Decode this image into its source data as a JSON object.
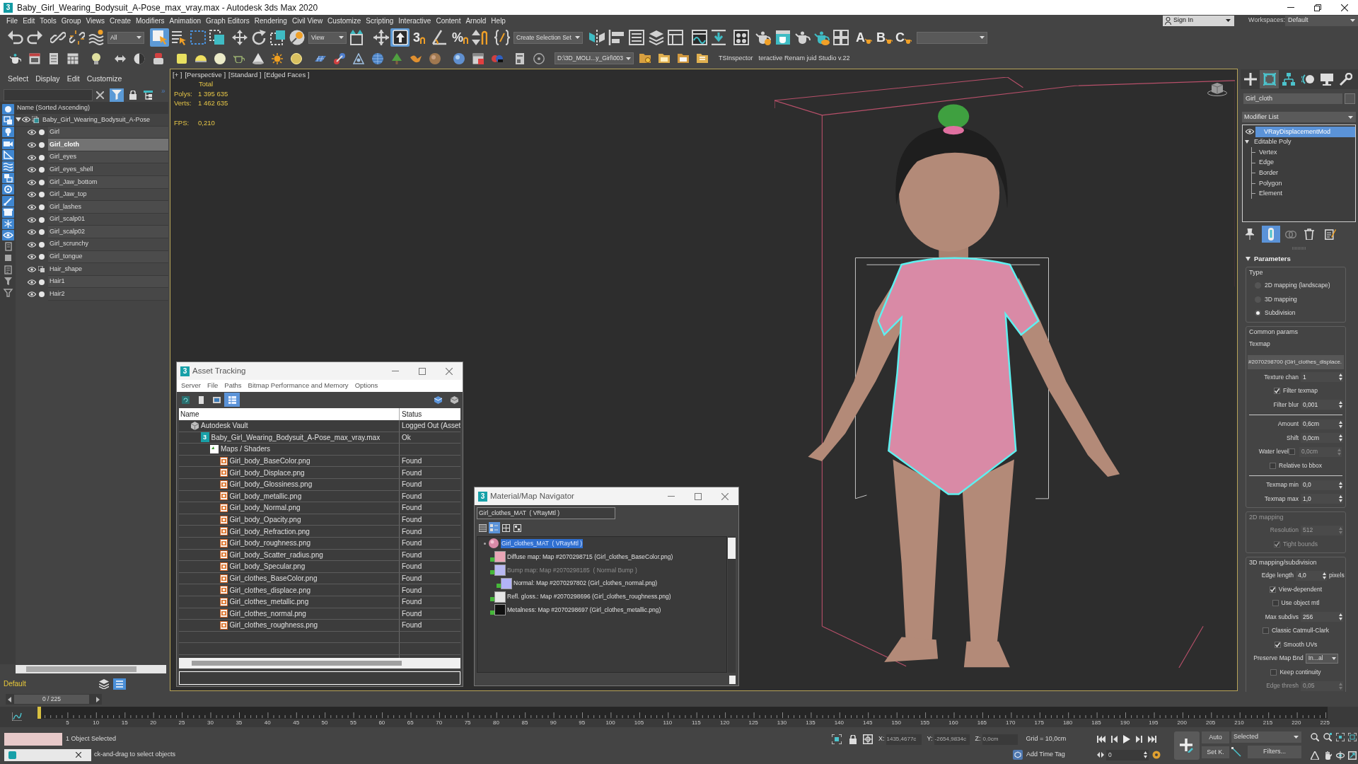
{
  "window": {
    "title": "Baby_Girl_Wearing_Bodysuit_A-Pose_max_vray.max - Autodesk 3ds Max 2020",
    "icon_label": "3"
  },
  "menu_bar": [
    "File",
    "Edit",
    "Tools",
    "Group",
    "Views",
    "Create",
    "Modifiers",
    "Animation",
    "Graph Editors",
    "Rendering",
    "Civil View",
    "Customize",
    "Scripting",
    "Interactive",
    "Content",
    "Arnold",
    "Help"
  ],
  "account": {
    "sign_in": "Sign In",
    "workspaces_label": "Workspaces:",
    "workspace": "Default"
  },
  "main_toolbar": [
    {
      "kind": "tool",
      "selected": false
    },
    {
      "kind": "tool",
      "selected": false
    },
    {
      "kind": "tool",
      "selected": false
    },
    {
      "kind": "tool",
      "selected": false
    },
    {
      "kind": "tool",
      "selected": false
    },
    {
      "kind": "dropdown",
      "value": "All"
    },
    {
      "kind": "tool",
      "selected": true
    },
    {
      "kind": "tool",
      "selected": false
    },
    {
      "kind": "tool",
      "selected": false
    },
    {
      "kind": "tool",
      "selected": false
    },
    {
      "kind": "tool",
      "selected": false
    },
    {
      "kind": "tool",
      "selected": false
    },
    {
      "kind": "tool",
      "selected": false
    },
    {
      "kind": "tool",
      "selected": false
    },
    {
      "kind": "dropdown",
      "value": "View"
    },
    {
      "kind": "tool",
      "selected": false
    },
    {
      "kind": "tool",
      "selected": false
    },
    {
      "kind": "tool",
      "selected": true
    },
    {
      "kind": "tool",
      "selected": false,
      "label": "3"
    },
    {
      "kind": "tool",
      "selected": false
    },
    {
      "kind": "tool",
      "selected": false,
      "label": "%"
    },
    {
      "kind": "tool",
      "selected": false
    },
    {
      "kind": "tool",
      "selected": false
    },
    {
      "kind": "dropdown",
      "value": "Create Selection Set"
    },
    {
      "kind": "tool",
      "selected": false
    },
    {
      "kind": "tool",
      "selected": false
    },
    {
      "kind": "tool",
      "selected": false
    },
    {
      "kind": "tool",
      "selected": false
    },
    {
      "kind": "tool",
      "selected": false
    },
    {
      "kind": "tool",
      "selected": false
    },
    {
      "kind": "tool",
      "selected": false
    },
    {
      "kind": "tool",
      "selected": false
    },
    {
      "kind": "tool",
      "selected": false
    },
    {
      "kind": "tool",
      "selected": false
    },
    {
      "kind": "tool",
      "selected": false
    },
    {
      "kind": "tool",
      "selected": false
    },
    {
      "kind": "tool",
      "selected": false
    },
    {
      "kind": "tool",
      "selected": false,
      "label": "A"
    },
    {
      "kind": "tool",
      "selected": false,
      "label": "B"
    },
    {
      "kind": "tool",
      "selected": false,
      "label": "C"
    },
    {
      "kind": "dropdown"
    }
  ],
  "secondary_toolbar": [
    {
      "kind": "tool",
      "selected": false
    },
    {
      "kind": "tool",
      "selected": false
    },
    {
      "kind": "tool",
      "selected": false
    },
    {
      "kind": "tool",
      "selected": false
    },
    {
      "kind": "tool",
      "selected": false
    },
    {
      "kind": "tool",
      "selected": false
    },
    {
      "kind": "tool",
      "selected": false
    },
    {
      "kind": "tool",
      "selected": false
    },
    {
      "kind": "tool",
      "selected": false
    },
    {
      "kind": "tool",
      "selected": false
    },
    {
      "kind": "tool",
      "selected": false
    },
    {
      "kind": "tool",
      "selected": false
    },
    {
      "kind": "tool",
      "selected": false
    },
    {
      "kind": "tool",
      "selected": false
    },
    {
      "kind": "tool",
      "selected": false
    },
    {
      "kind": "tool",
      "selected": false
    },
    {
      "kind": "tool",
      "selected": false
    },
    {
      "kind": "tool",
      "selected": false
    },
    {
      "kind": "tool",
      "selected": false
    },
    {
      "kind": "tool",
      "selected": false
    },
    {
      "kind": "tool",
      "selected": false
    },
    {
      "kind": "tool",
      "selected": false
    },
    {
      "kind": "tool",
      "selected": false
    },
    {
      "kind": "tool",
      "selected": false
    },
    {
      "kind": "tool",
      "selected": false
    },
    {
      "kind": "tool",
      "selected": false
    },
    {
      "kind": "tool",
      "selected": false
    },
    {
      "kind": "dropdown",
      "value": "D:\\3D_MOLI...y_Girl\\003"
    },
    {
      "kind": "tool",
      "selected": false
    },
    {
      "kind": "tool",
      "selected": false
    },
    {
      "kind": "tool",
      "selected": false
    },
    {
      "kind": "tool",
      "selected": false
    },
    {
      "kind": "text",
      "value": "TSInspector"
    },
    {
      "kind": "text",
      "value": "teractive Renam juid Studio v.22"
    }
  ],
  "scene_explorer": {
    "menu": [
      "Select",
      "Display",
      "Edit",
      "Customize"
    ],
    "filter_on": true,
    "overflow": "»",
    "column": "Name (Sorted Ascending)",
    "category_filters": [
      {
        "on": true
      },
      {
        "on": true
      },
      {
        "on": true
      },
      {
        "on": true
      },
      {
        "on": true
      },
      {
        "on": true
      },
      {
        "on": true
      },
      {
        "on": true
      },
      {
        "on": true
      },
      {
        "on": true
      },
      {
        "on": true
      },
      {
        "on": true
      },
      {
        "on": false
      },
      {
        "on": false
      },
      {
        "on": false
      },
      {
        "on": false
      },
      {
        "on": false
      }
    ],
    "tree": [
      {
        "name": "Baby_Girl_Wearing_Bodysuit_A-Pose",
        "kind": "group",
        "selected": false,
        "expanded": true,
        "children": [
          {
            "name": "Girl",
            "kind": "mesh",
            "selected": false
          },
          {
            "name": "Girl_cloth",
            "kind": "mesh",
            "selected": true
          },
          {
            "name": "Girl_eyes",
            "kind": "mesh",
            "selected": false
          },
          {
            "name": "Girl_eyes_shell",
            "kind": "mesh",
            "selected": false
          },
          {
            "name": "Girl_Jaw_bottom",
            "kind": "mesh",
            "selected": false
          },
          {
            "name": "Girl_Jaw_top",
            "kind": "mesh",
            "selected": false
          },
          {
            "name": "Girl_lashes",
            "kind": "mesh",
            "selected": false
          },
          {
            "name": "Girl_scalp01",
            "kind": "mesh",
            "selected": false
          },
          {
            "name": "Girl_scalp02",
            "kind": "mesh",
            "selected": false
          },
          {
            "name": "Girl_scrunchy",
            "kind": "mesh",
            "selected": false
          },
          {
            "name": "Girl_tongue",
            "kind": "mesh",
            "selected": false
          },
          {
            "name": "Hair_shape",
            "kind": "hair",
            "selected": false
          },
          {
            "name": "Hair1",
            "kind": "mesh",
            "selected": false
          },
          {
            "name": "Hair2",
            "kind": "mesh",
            "selected": false
          }
        ]
      }
    ],
    "layer": "Default"
  },
  "viewport": {
    "active": true,
    "labels": [
      "[+ ]",
      "[Perspective ]",
      "[Standard ]",
      "[Edged Faces ]"
    ],
    "stats_header": "Total",
    "stats": [
      {
        "label": "Polys:",
        "value": "1 395 635"
      },
      {
        "label": "Verts:",
        "value": "1 462 635"
      },
      {
        "label": "FPS:",
        "value": "0,210"
      }
    ]
  },
  "command_panel": {
    "tabs": [
      {
        "selected": false
      },
      {
        "selected": true
      },
      {
        "selected": false
      },
      {
        "selected": false
      },
      {
        "selected": false
      },
      {
        "selected": false
      }
    ],
    "object_name": "Girl_cloth",
    "modifier_list": "Modifier List",
    "stack": [
      {
        "name": "VRayDisplacementMod",
        "selected": true
      },
      {
        "name": "Editable Poly",
        "selected": false,
        "expanded": true,
        "children": [
          {
            "name": "Vertex",
            "selected": false
          },
          {
            "name": "Edge",
            "selected": false
          },
          {
            "name": "Border",
            "selected": false
          },
          {
            "name": "Polygon",
            "selected": false
          },
          {
            "name": "Element",
            "selected": false
          }
        ]
      }
    ],
    "stack_tools": [
      {
        "selected": false
      },
      {
        "selected": true
      },
      {
        "selected": false
      },
      {
        "selected": false
      },
      {
        "selected": false
      }
    ],
    "rollout": {
      "title": "Parameters",
      "expanded": true,
      "groups": [
        {
          "title": "Type",
          "disabled": false,
          "rows": [
            {
              "kind": "radio",
              "label": "2D mapping (landscape)",
              "selected": false
            },
            {
              "kind": "radio",
              "label": "3D mapping",
              "selected": false
            },
            {
              "kind": "radio",
              "label": "Subdivision",
              "selected": true
            }
          ]
        },
        {
          "title": "Common params",
          "disabled": false,
          "rows": [
            {
              "kind": "label",
              "label": "Texmap"
            },
            {
              "kind": "map_button",
              "label": "#2070298700 (Girl_clothes_displace."
            },
            {
              "kind": "spinner",
              "label": "Texture chan",
              "value": "1"
            },
            {
              "kind": "check",
              "label": "Filter texmap",
              "checked": true
            },
            {
              "kind": "spinner",
              "label": "Filter blur",
              "value": "0,001"
            },
            {
              "kind": "rule"
            },
            {
              "kind": "spinner",
              "label": "Amount",
              "value": "0,6cm"
            },
            {
              "kind": "spinner",
              "label": "Shift",
              "value": "0,0cm"
            },
            {
              "kind": "check_spinner",
              "label": "Water level",
              "checked": false,
              "value": "0,0cm"
            },
            {
              "kind": "check",
              "label": "Relative to bbox",
              "checked": false
            },
            {
              "kind": "rule"
            },
            {
              "kind": "spinner",
              "label": "Texmap min",
              "value": "0,0"
            },
            {
              "kind": "spinner",
              "label": "Texmap max",
              "value": "1,0"
            }
          ]
        },
        {
          "title": "2D mapping",
          "disabled": true,
          "rows": [
            {
              "kind": "spinner",
              "label": "Resolution",
              "value": "512"
            },
            {
              "kind": "check",
              "label": "Tight bounds",
              "checked": true
            }
          ]
        },
        {
          "title": "3D mapping/subdivision",
          "disabled": false,
          "rows": [
            {
              "kind": "spinner",
              "label": "Edge length",
              "value": "4,0",
              "unit": "pixels"
            },
            {
              "kind": "check",
              "label": "View-dependent",
              "checked": true
            },
            {
              "kind": "check",
              "label": "Use object mtl",
              "checked": false
            },
            {
              "kind": "spinner",
              "label": "Max subdivs",
              "value": "256"
            },
            {
              "kind": "check",
              "label": "Classic Catmull-Clark",
              "checked": false
            },
            {
              "kind": "check",
              "label": "Smooth UVs",
              "checked": true
            },
            {
              "kind": "dropdown",
              "label": "Preserve Map Bnd",
              "value": "In...al"
            },
            {
              "kind": "check",
              "label": "Keep continuity",
              "checked": false
            },
            {
              "kind": "spinner",
              "label": "Edge thresh",
              "value": "0,05",
              "disabled": true
            }
          ]
        }
      ]
    }
  },
  "asset_tracking": {
    "title": "Asset Tracking",
    "icon_label": "3",
    "menu": [
      "Server",
      "File",
      "Paths",
      "Bitmap Performance and Memory",
      "Options"
    ],
    "view_buttons": [
      {
        "selected": false
      },
      {
        "selected": false
      },
      {
        "selected": false
      },
      {
        "selected": true
      }
    ],
    "columns": [
      "Name",
      "Status"
    ],
    "assets": [
      {
        "name": "Autodesk Vault",
        "status": "Logged Out (Asset",
        "kind": "vault",
        "children": [
          {
            "name": "Baby_Girl_Wearing_Bodysuit_A-Pose_max_vray.max",
            "status": "Ok",
            "kind": "scene",
            "icon_label": "3",
            "children": [
              {
                "name": "Maps / Shaders",
                "kind": "folder",
                "children": [
                  {
                    "name": "Girl_body_BaseColor.png",
                    "status": "Found",
                    "kind": "bitmap"
                  },
                  {
                    "name": "Girl_body_Displace.png",
                    "status": "Found",
                    "kind": "bitmap"
                  },
                  {
                    "name": "Girl_body_Glossiness.png",
                    "status": "Found",
                    "kind": "bitmap"
                  },
                  {
                    "name": "Girl_body_metallic.png",
                    "status": "Found",
                    "kind": "bitmap"
                  },
                  {
                    "name": "Girl_body_Normal.png",
                    "status": "Found",
                    "kind": "bitmap"
                  },
                  {
                    "name": "Girl_body_Opacity.png",
                    "status": "Found",
                    "kind": "bitmap"
                  },
                  {
                    "name": "Girl_body_Refraction.png",
                    "status": "Found",
                    "kind": "bitmap"
                  },
                  {
                    "name": "Girl_body_roughness.png",
                    "status": "Found",
                    "kind": "bitmap"
                  },
                  {
                    "name": "Girl_body_Scatter_radius.png",
                    "status": "Found",
                    "kind": "bitmap"
                  },
                  {
                    "name": "Girl_body_Specular.png",
                    "status": "Found",
                    "kind": "bitmap"
                  },
                  {
                    "name": "Girl_clothes_BaseColor.png",
                    "status": "Found",
                    "kind": "bitmap"
                  },
                  {
                    "name": "Girl_clothes_displace.png",
                    "status": "Found",
                    "kind": "bitmap"
                  },
                  {
                    "name": "Girl_clothes_metallic.png",
                    "status": "Found",
                    "kind": "bitmap"
                  },
                  {
                    "name": "Girl_clothes_normal.png",
                    "status": "Found",
                    "kind": "bitmap"
                  },
                  {
                    "name": "Girl_clothes_roughness.png",
                    "status": "Found",
                    "kind": "bitmap"
                  }
                ]
              }
            ]
          }
        ]
      }
    ]
  },
  "material_navigator": {
    "title": "Material/Map Navigator",
    "icon_label": "3",
    "material": "Girl_clothes_MAT  ( VRayMtl )",
    "view_buttons": [
      {
        "selected": false
      },
      {
        "selected": true
      },
      {
        "selected": false
      },
      {
        "selected": false
      }
    ],
    "tree": [
      {
        "label": "Girl_clothes_MAT  ( VRayMtl )",
        "kind": "material",
        "selected": true,
        "expanded": true,
        "children": [
          {
            "label": "Diffuse map: Map #2070298715 (Girl_clothes_BaseColor.png)",
            "kind": "map",
            "color": "#e9a6b6",
            "disabled": false
          },
          {
            "label": "Bump map: Map #2070298185  ( Normal Bump )",
            "kind": "map",
            "color": "#b9b9f2",
            "disabled": true,
            "children": [
              {
                "label": "Normal: Map #2070297802 (Girl_clothes_normal.png)",
                "kind": "map",
                "color": "#b3b3f7",
                "disabled": false
              }
            ]
          },
          {
            "label": "Refl. gloss.: Map #2070298696 (Girl_clothes_roughness.png)",
            "kind": "map",
            "color": "#e6e6e6",
            "disabled": false
          },
          {
            "label": "Metalness: Map #2070298697 (Girl_clothes_metallic.png)",
            "kind": "map",
            "color": "#101010",
            "disabled": false
          }
        ]
      }
    ]
  },
  "frame_counter": {
    "label": "0 / 225"
  },
  "timeline": {
    "level": 0,
    "ticks": [
      "5",
      "10",
      "15",
      "20",
      "25",
      "30",
      "35",
      "40",
      "45",
      "50",
      "55",
      "60",
      "65",
      "70",
      "75",
      "80",
      "85",
      "90",
      "95",
      "100",
      "105",
      "110",
      "115",
      "120",
      "125",
      "130",
      "135",
      "140",
      "145",
      "150",
      "155",
      "160",
      "165",
      "170",
      "175",
      "180",
      "185",
      "190",
      "195",
      "200",
      "205",
      "210",
      "215",
      "220",
      "225"
    ]
  },
  "status_bar": {
    "selection": "1 Object Selected",
    "prompt": "ck-and-drag to select objects",
    "coords": [
      {
        "axis": "X:",
        "value": "1435,4677c"
      },
      {
        "axis": "Y:",
        "value": "-2654,9834c"
      },
      {
        "axis": "Z:",
        "value": "0,0cm"
      }
    ],
    "grid": "Grid = 10,0cm",
    "time_tag": "Add Time Tag",
    "frame": "0",
    "auto_key": {
      "label": "Auto",
      "on": false
    },
    "key_filter": "Selected",
    "set_key": "Set K.",
    "filters": "Filters..."
  }
}
